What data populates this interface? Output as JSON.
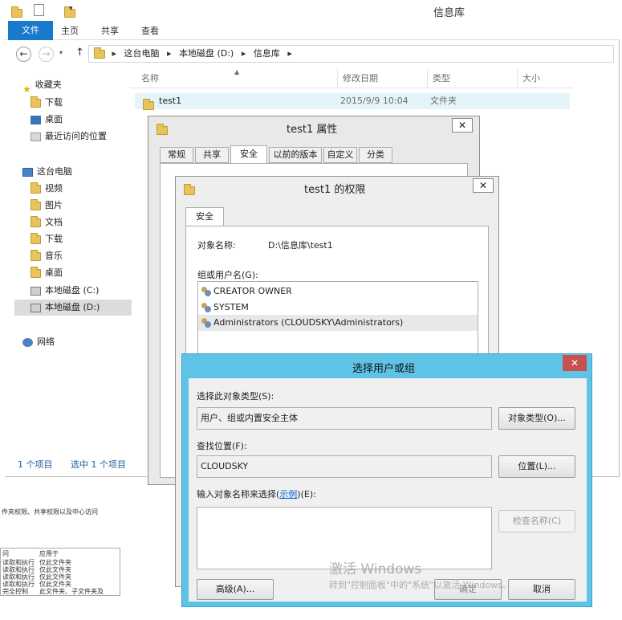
{
  "explorer": {
    "title": "信息库",
    "ribbon_tabs": [
      "文件",
      "主页",
      "共享",
      "查看"
    ],
    "breadcrumb": [
      "这台电脑",
      "本地磁盘 (D:)",
      "信息库"
    ],
    "columns": {
      "name": "名称",
      "date": "修改日期",
      "type": "类型",
      "size": "大小"
    },
    "row": {
      "name": "test1",
      "date": "2015/9/9 10:04",
      "type": "文件夹"
    },
    "nav": {
      "favorites": "收藏夹",
      "fav_items": [
        "下载",
        "桌面",
        "最近访问的位置"
      ],
      "this_pc": "这台电脑",
      "pc_items": [
        "视频",
        "图片",
        "文档",
        "下载",
        "音乐",
        "桌面",
        "本地磁盘 (C:)",
        "本地磁盘 (D:)"
      ],
      "network": "网络"
    },
    "status_count": "1 个项目",
    "status_selected": "选中 1 个项目"
  },
  "background_snippets": {
    "line1": "件夹权限、共享权限以及中心访问",
    "col1": "问",
    "col2": "应用于",
    "rows": [
      [
        "读取和执行",
        "仅此文件夹"
      ],
      [
        "读取和执行",
        "仅此文件夹"
      ],
      [
        "读取和执行",
        "仅此文件夹"
      ],
      [
        "读取和执行",
        "仅此文件夹"
      ],
      [
        "完全控制",
        "此文件夹、子文件夹及"
      ]
    ]
  },
  "props_dialog": {
    "title": "test1 属性",
    "tabs": [
      "常规",
      "共享",
      "安全",
      "以前的版本",
      "自定义",
      "分类"
    ]
  },
  "perm_dialog": {
    "title": "test1 的权限",
    "tab": "安全",
    "object_label": "对象名称:",
    "object_value": "D:\\信息库\\test1",
    "group_label": "组或用户名(G):",
    "users": [
      "CREATOR OWNER",
      "SYSTEM",
      "Administrators (CLOUDSKY\\Administrators)"
    ]
  },
  "select_dialog": {
    "title": "选择用户或组",
    "object_type_label": "选择此对象类型(S):",
    "object_type_value": "用户、组或内置安全主体",
    "object_type_button": "对象类型(O)...",
    "location_label": "查找位置(F):",
    "location_value": "CLOUDSKY",
    "location_button": "位置(L)...",
    "names_label_prefix": "输入对象名称来选择(",
    "names_label_link": "示例",
    "names_label_suffix": ")(E):",
    "check_button": "检查名称(C)",
    "advanced_button": "高级(A)...",
    "ok_button": "确定",
    "cancel_button": "取消"
  },
  "watermark": {
    "line1": "激活 Windows",
    "line2": "转到\"控制面板\"中的\"系统\"以激活 Windows。"
  },
  "colors": {
    "ribbon_blue": "#1979ca",
    "dialog_accent": "#5ec3e6",
    "close_red": "#c75050",
    "link_blue": "#0066cc"
  }
}
